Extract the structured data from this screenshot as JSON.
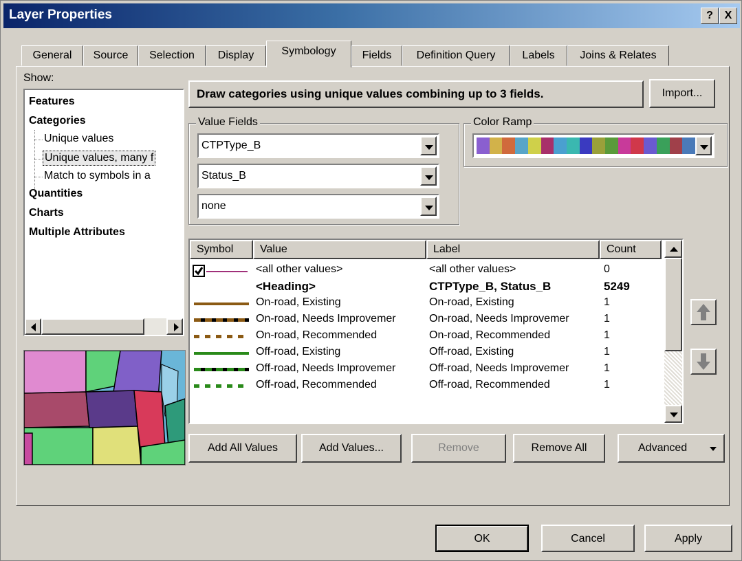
{
  "window": {
    "title": "Layer Properties",
    "help_label": "?",
    "close_label": "X"
  },
  "tabs": [
    {
      "label": "General"
    },
    {
      "label": "Source"
    },
    {
      "label": "Selection"
    },
    {
      "label": "Display"
    },
    {
      "label": "Symbology"
    },
    {
      "label": "Fields"
    },
    {
      "label": "Definition Query"
    },
    {
      "label": "Labels"
    },
    {
      "label": "Joins & Relates"
    }
  ],
  "show": {
    "label": "Show:",
    "items": [
      {
        "label": "Features"
      },
      {
        "label": "Categories"
      },
      {
        "label": "Unique values"
      },
      {
        "label": "Unique values, many f"
      },
      {
        "label": "Match to symbols in a"
      },
      {
        "label": "Quantities"
      },
      {
        "label": "Charts"
      },
      {
        "label": "Multiple Attributes"
      }
    ]
  },
  "description": "Draw categories using unique values combining up to 3 fields.",
  "import_label": "Import...",
  "value_fields": {
    "label": "Value Fields",
    "fields": [
      "CTPType_B",
      "Status_B",
      "none"
    ]
  },
  "color_ramp": {
    "label": "Color Ramp",
    "colors": [
      "#8a5fd0",
      "#d2b24a",
      "#d06a3c",
      "#58a5c8",
      "#cfd04a",
      "#a8306a",
      "#4aa0d0",
      "#3ab8b0",
      "#3a3ac0",
      "#9aa03a",
      "#5a9a3a",
      "#c83a9a",
      "#d0384a",
      "#6a5ad0",
      "#3aa05a",
      "#a0404a",
      "#4a7ab8"
    ]
  },
  "table": {
    "headers": {
      "symbol": "Symbol",
      "value": "Value",
      "label": "Label",
      "count": "Count"
    },
    "rows": [
      {
        "value": "<all other values>",
        "label": "<all other values>",
        "count": "0",
        "bold": false
      },
      {
        "value": "<Heading>",
        "label": "CTPType_B, Status_B",
        "count": "5249",
        "bold": true
      },
      {
        "value": "On-road, Existing",
        "label": "On-road, Existing",
        "count": "1",
        "bold": false
      },
      {
        "value": "On-road, Needs Improvemer",
        "label": "On-road, Needs Improvemer",
        "count": "1",
        "bold": false
      },
      {
        "value": "On-road, Recommended",
        "label": "On-road, Recommended",
        "count": "1",
        "bold": false
      },
      {
        "value": "Off-road, Existing",
        "label": "Off-road, Existing",
        "count": "1",
        "bold": false
      },
      {
        "value": "Off-road, Needs Improvemer",
        "label": "Off-road, Needs Improvemer",
        "count": "1",
        "bold": false
      },
      {
        "value": "Off-road, Recommended",
        "label": "Off-road, Recommended",
        "count": "1",
        "bold": false
      }
    ]
  },
  "buttons": {
    "add_all": "Add All Values",
    "add_values": "Add Values...",
    "remove": "Remove",
    "remove_all": "Remove All",
    "advanced": "Advanced",
    "ok": "OK",
    "cancel": "Cancel",
    "apply": "Apply"
  },
  "colors": {
    "title_start": "#0a246a",
    "title_end": "#a6caf0",
    "face": "#d4d0c8",
    "brown": "#8b5a14",
    "green": "#2ca02c"
  },
  "icons": {
    "up": "up-arrow-icon",
    "down": "down-arrow-icon",
    "check": "checkmark-icon"
  }
}
